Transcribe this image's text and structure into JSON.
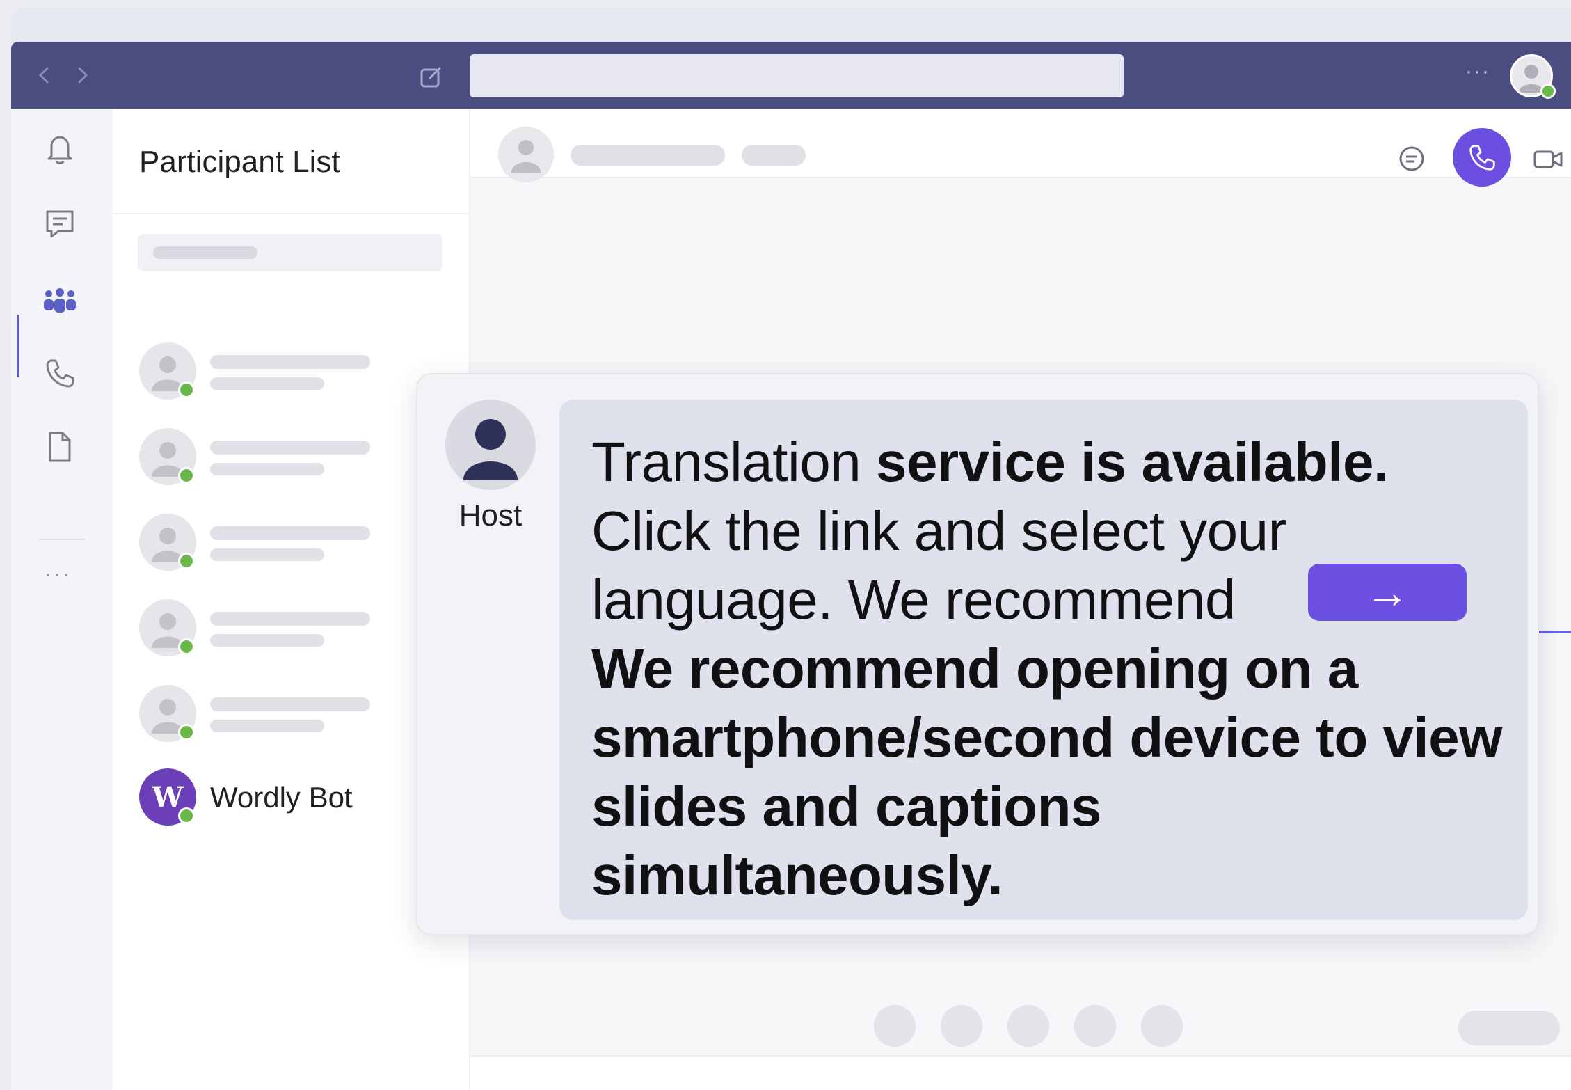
{
  "colors": {
    "titlebar": "#4b4d80",
    "accent": "#6b4fe0",
    "presence": "#6bb84a",
    "bot_avatar": "#6a3fb8"
  },
  "titlebar": {
    "back_icon": "chevron-left-icon",
    "forward_icon": "chevron-right-icon",
    "compose_icon": "compose-icon",
    "more_label": "···",
    "profile_icon": "avatar"
  },
  "rail": {
    "items": [
      {
        "icon": "bell-icon"
      },
      {
        "icon": "chat-icon"
      },
      {
        "icon": "teams-icon",
        "active": true
      },
      {
        "icon": "phone-icon"
      },
      {
        "icon": "file-icon"
      }
    ],
    "more_label": "···"
  },
  "panel": {
    "title": "Participant List",
    "participants_count_placeholders": 5,
    "bot": {
      "avatar_letter": "W",
      "name": "Wordly Bot"
    }
  },
  "chat_header": {
    "chat_icon": "chat-bubble-icon",
    "call_icon": "phone-icon",
    "video_icon": "video-icon"
  },
  "message": {
    "sender": "Host",
    "text_regular_1": "Translation ",
    "text_bold_1": "service is available.",
    "text_regular_2": "Click the link and select your language. We recommend",
    "link_arrow": "→",
    "text_bold_2": "We recommend opening on a smartphone/second device to view slides and captions simultaneously."
  }
}
